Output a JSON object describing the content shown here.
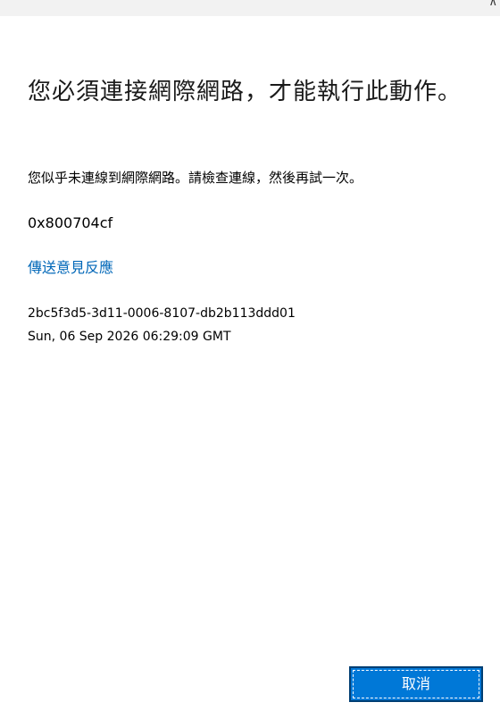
{
  "top_bar": {
    "corner_icon": "chevron-icon"
  },
  "dialog": {
    "title": "您必須連接網際網路，才能執行此動作。",
    "message": "您似乎未連線到網際網路。請檢查連線，然後再試一次。",
    "error_code": "0x800704cf",
    "feedback_link": "傳送意見反應",
    "correlation_id": "2bc5f3d5-3d11-0006-8107-db2b113ddd01",
    "timestamp": "Sun, 06 Sep 2026 06:29:09 GMT"
  },
  "buttons": {
    "cancel_label": "取消"
  },
  "colors": {
    "accent": "#0078d7",
    "link": "#0067b8",
    "top_bar": "#f2f2f2"
  }
}
